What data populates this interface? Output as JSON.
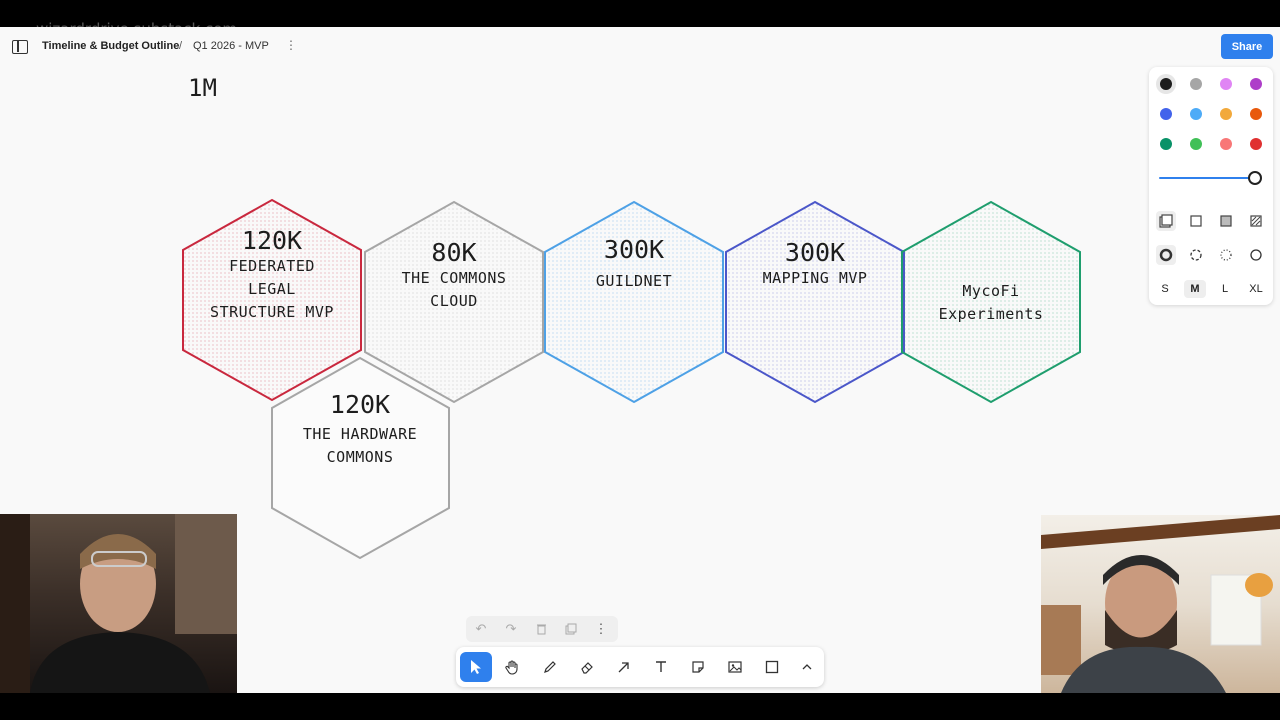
{
  "watermark": "wizardrdrive.substack.com",
  "header": {
    "title": "Timeline & Budget Outline",
    "separator": "/",
    "page": "Q1 2026 - MVP",
    "more_icon": "more-vertical-icon",
    "share_label": "Share"
  },
  "canvas": {
    "total_label": "1M",
    "hexagons": [
      {
        "amount": "120K",
        "label_lines": [
          "FEDERATED",
          "LEGAL",
          "STRUCTURE MVP"
        ],
        "color": "#c9283e"
      },
      {
        "amount": "80K",
        "label_lines": [
          "THE COMMONS",
          "CLOUD"
        ],
        "color": "#a6a6a6"
      },
      {
        "amount": "300K",
        "label_lines": [
          "GUILDNET"
        ],
        "color": "#4ea1e6"
      },
      {
        "amount": "300K",
        "label_lines": [
          "MAPPING MVP"
        ],
        "color": "#4b57c9"
      },
      {
        "amount": "",
        "label_lines": [
          "MycoFi",
          "Experiments"
        ],
        "color": "#1f9e6e"
      },
      {
        "amount": "120K",
        "label_lines": [
          "THE HARDWARE",
          "COMMONS"
        ],
        "color": "#a6a6a6"
      }
    ]
  },
  "style_panel": {
    "colors": [
      "#1d1d1d",
      "#a6a6a6",
      "#e085f4",
      "#ae3ec9",
      "#4263eb",
      "#4dabf7",
      "#f2a93b",
      "#e8590c",
      "#099268",
      "#40c057",
      "#f87777",
      "#e03131"
    ],
    "selected_color": "#1d1d1d",
    "opacity": 1.0,
    "sizes": [
      "S",
      "M",
      "L",
      "XL"
    ],
    "selected_size": "M"
  },
  "toolbar": {
    "tools": [
      "select-icon",
      "hand-icon",
      "draw-icon",
      "eraser-icon",
      "arrow-icon",
      "text-icon",
      "note-icon",
      "image-icon",
      "rectangle-icon",
      "chevron-up-icon"
    ],
    "active_tool": "select-icon"
  },
  "action_bar": [
    "undo-icon",
    "redo-icon",
    "trash-icon",
    "duplicate-icon",
    "more-vertical-icon"
  ]
}
